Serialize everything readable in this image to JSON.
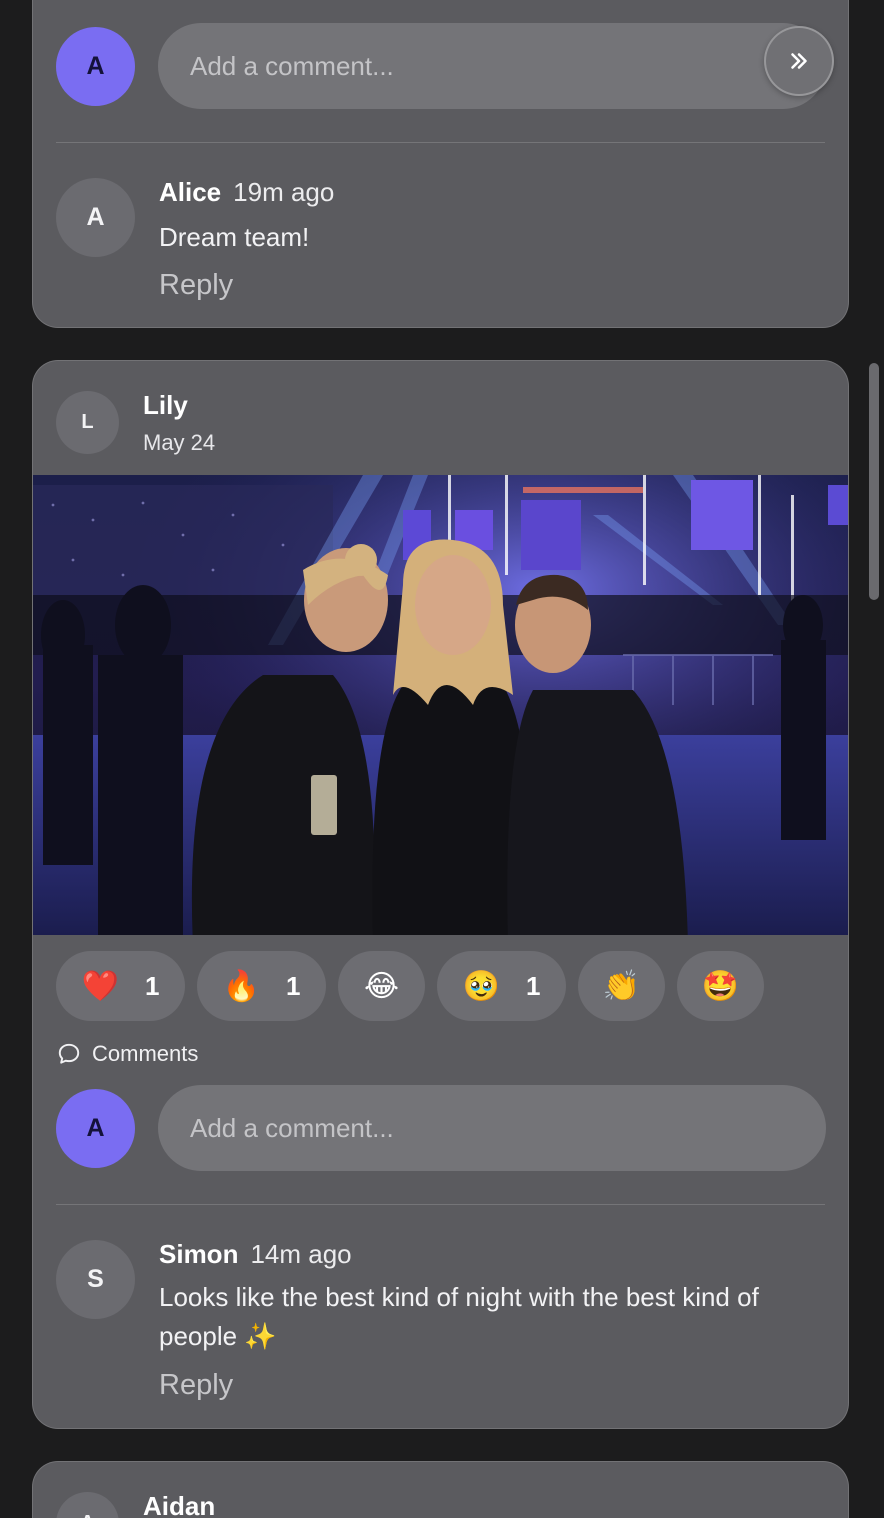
{
  "current_user": {
    "initial": "A"
  },
  "top_post": {
    "comment_placeholder": "Add a comment...",
    "comments": [
      {
        "initial": "A",
        "author": "Alice",
        "time": "19m ago",
        "text": "Dream team!",
        "reply_label": "Reply"
      }
    ]
  },
  "post": {
    "author_initial": "L",
    "author": "Lily",
    "date": "May 24",
    "reactions": [
      {
        "emoji": "❤️",
        "count": "1"
      },
      {
        "emoji": "🔥",
        "count": "1"
      },
      {
        "emoji": "😂",
        "count": ""
      },
      {
        "emoji": "🥹",
        "count": "1"
      },
      {
        "emoji": "👏",
        "count": ""
      },
      {
        "emoji": "🤩",
        "count": ""
      }
    ],
    "comments_label": "Comments",
    "comment_placeholder": "Add a comment...",
    "comments": [
      {
        "initial": "S",
        "author": "Simon",
        "time": "14m ago",
        "text": "Looks like the best kind of night with the best kind of people ✨",
        "reply_label": "Reply"
      }
    ]
  },
  "next_post": {
    "author_initial": "A",
    "author": "Aidan"
  },
  "icons": {
    "send": "double-chevron-right-icon",
    "comments": "speech-bubble-icon"
  },
  "colors": {
    "accent": "#7a6df2",
    "card": "#5b5b5f",
    "background": "#1c1c1d"
  }
}
